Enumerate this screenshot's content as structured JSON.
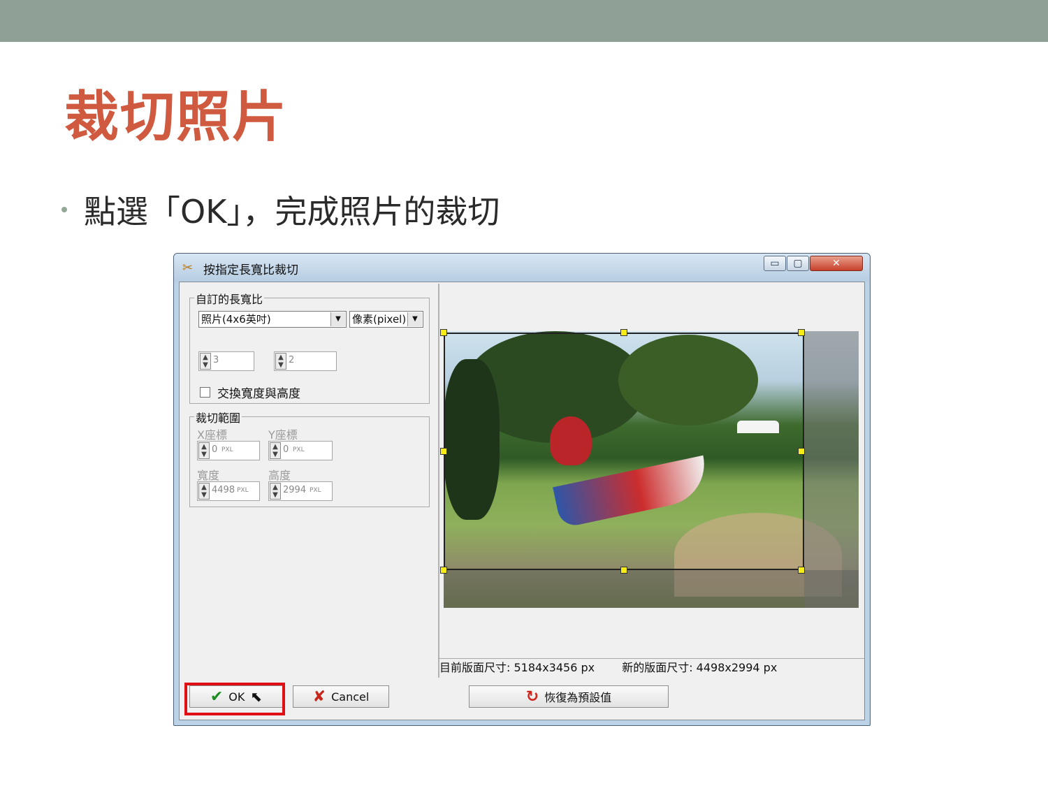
{
  "slide": {
    "title": "裁切照片",
    "bullet": "點選「OK」，完成照片的裁切"
  },
  "dialog": {
    "title": "按指定長寬比裁切",
    "title_buttons": {
      "minimize": "▭",
      "maximize": "▢",
      "close": "✕"
    },
    "aspect_group": {
      "label": "自訂的長寬比",
      "preset_selected": "照片(4x6英吋)",
      "unit_selected": "像素(pixel)",
      "width_ratio": "3",
      "height_ratio": "2",
      "swap_label": "交換寬度與高度",
      "swap_checked": false
    },
    "crop_group": {
      "label": "裁切範圍",
      "x_label": "X座標",
      "y_label": "Y座標",
      "x_value": "0",
      "y_value": "0",
      "width_label": "寬度",
      "height_label": "高度",
      "width_value": "4498",
      "height_value": "2994",
      "unit": "PXL"
    },
    "status": {
      "current_size": "目前版面尺寸: 5184x3456 px",
      "new_size": "新的版面尺寸: 4498x2994 px"
    },
    "buttons": {
      "ok": "OK",
      "cancel": "Cancel",
      "reset": "恢復為預設值"
    },
    "icons": {
      "app": "scissors-icon",
      "ok": "check-icon",
      "cancel": "x-icon",
      "reset": "refresh-icon"
    },
    "colors": {
      "highlight": "#e00f16",
      "handle": "#f5ec18",
      "title_accent": "#cf5a3f"
    }
  }
}
